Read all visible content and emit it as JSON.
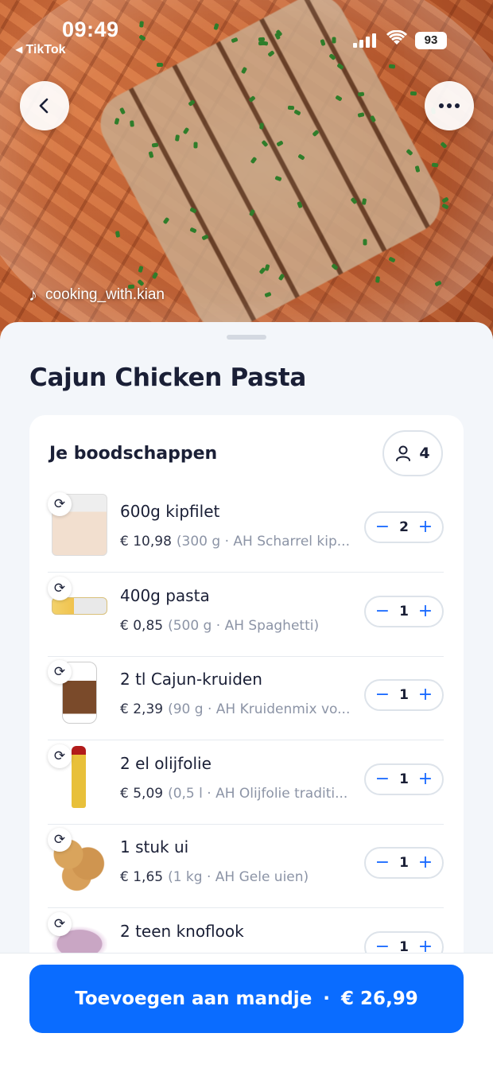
{
  "status_bar": {
    "time": "09:49",
    "back_app": "◂ TikTok",
    "battery": "93"
  },
  "hero": {
    "creator_handle": "cooking_with.kian"
  },
  "recipe": {
    "title": "Cajun Chicken Pasta"
  },
  "groceries": {
    "title": "Je boodschappen",
    "persons": "4",
    "items": [
      {
        "name": "600g kipfilet",
        "price": "€ 10,98",
        "detail": "(300 g · AH Scharrel kip...",
        "qty": "2",
        "thumb": "t-chicken"
      },
      {
        "name": "400g pasta",
        "price": "€ 0,85",
        "detail": "(500 g · AH Spaghetti)",
        "qty": "1",
        "thumb": "t-pasta"
      },
      {
        "name": "2 tl Cajun-kruiden",
        "price": "€ 2,39",
        "detail": "(90 g · AH Kruidenmix vo...",
        "qty": "1",
        "thumb": "t-cajun"
      },
      {
        "name": "2 el olijfolie",
        "price": "€ 5,09",
        "detail": "(0,5 l · AH Olijfolie traditi...",
        "qty": "1",
        "thumb": "t-oil"
      },
      {
        "name": "1 stuk ui",
        "price": "€ 1,65",
        "detail": "(1 kg · AH Gele uien)",
        "qty": "1",
        "thumb": "t-onion"
      },
      {
        "name": "2 teen knoflook",
        "price": "",
        "detail": "",
        "qty": "1",
        "thumb": "t-garlic"
      }
    ]
  },
  "cta": {
    "label": "Toevoegen aan mandje",
    "separator": "·",
    "total": "€ 26,99"
  },
  "icons": {
    "back": "chevron-left-icon",
    "more": "more-horizontal-icon",
    "swap": "refresh-icon",
    "person": "person-icon",
    "minus": "minus-icon",
    "plus": "plus-icon"
  },
  "colors": {
    "accent": "#0a6cff",
    "background": "#f3f6fa",
    "text": "#1a1f36",
    "muted": "#8c94a6"
  }
}
